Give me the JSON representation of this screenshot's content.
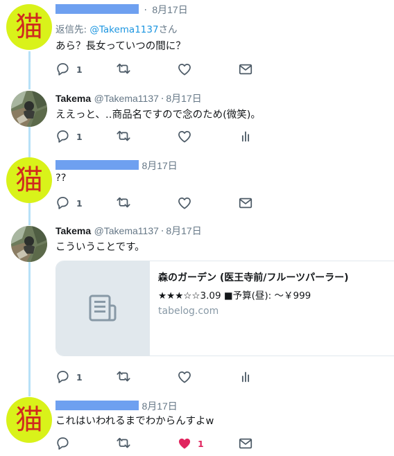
{
  "colors": {
    "accent": "#1b95e0",
    "like": "#e0245e",
    "thread": "#b7e1f8",
    "cat_bg": "#d9f21a",
    "cat_text": "#cf2a1f",
    "redaction": "#6ea0f0"
  },
  "tweets": [
    {
      "avatar_glyph": "猫",
      "date": "8月17日",
      "reply_prefix": "返信先: ",
      "reply_handle": "@Takema1137",
      "reply_suffix": "さん",
      "text": "あら？長女っていつの間に？",
      "reply_count": "1",
      "third_action_icon": "mail-icon"
    },
    {
      "name": "Takema",
      "handle": "@Takema1137",
      "separator": "·",
      "date": "8月17日",
      "text": "ええっと、‥商品名ですので念のため(微笑)。",
      "reply_count": "1",
      "third_action_icon": "analytics-icon"
    },
    {
      "avatar_glyph": "猫",
      "date": "8月17日",
      "text": "??",
      "reply_count": "1",
      "third_action_icon": "mail-icon"
    },
    {
      "name": "Takema",
      "handle": "@Takema1137",
      "separator": "·",
      "date": "8月17日",
      "text": "こういうことです。",
      "reply_count": "1",
      "third_action_icon": "analytics-icon",
      "card": {
        "title": "森のガーデン (医王寺前/フルーツパーラー)",
        "description": "★★★☆☆3.09 ■予算(昼): ～￥999",
        "domain": "tabelog.com",
        "thumb_icon": "document-icon"
      }
    },
    {
      "avatar_glyph": "猫",
      "date": "8月17日",
      "text": "これはいわれるまでわからんすよw",
      "like_count": "1",
      "liked": true,
      "third_action_icon": "mail-icon"
    }
  ]
}
